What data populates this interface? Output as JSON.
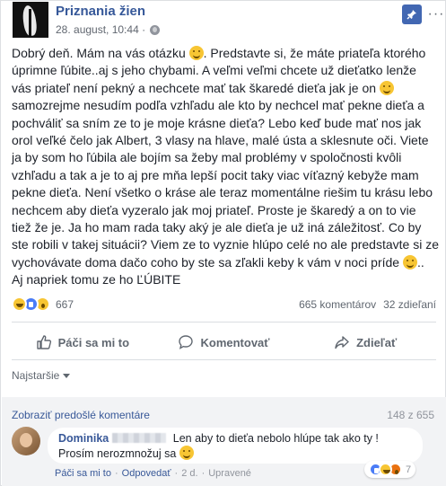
{
  "post": {
    "page_name": "Priznania žien",
    "date": "28. august, 10:44 ·",
    "text": {
      "l1": "Dobrý deň. Mám na vás otázku",
      "l1b": ". Predstavte si, že máte priateľa ktorého",
      "l2": "úprimne ľúbite..aj s jeho chybami. A veľmi veľmi chcete už dieťatko lenže",
      "l3": "vás priateľ není pekný a nechcete mať tak škaredé dieťa jak je on",
      "l4": "samozrejme nesudím podľa vzhľadu ale kto by nechcel mať pekne dieťa a",
      "l5": "pochváliť sa sním ze to je moje krásne dieťa? Lebo keď bude mať nos jak",
      "l6": "orol veľké čelo jak Albert, 3 vlasy na hlave, malé ústa a sklesnute oči. Viete",
      "l7": "ja by som ho ľúbila ale bojím sa žeby mal problémy v spoločnosti kvôli",
      "l8": "vzhľadu a tak a je to aj pre mňa lepší pocit taky viac víťazný kebyže mam",
      "l9": "pekne dieťa. Není všetko o kráse ale teraz momentálne riešim tu krásu lebo",
      "l10": "nechcem aby dieťa vyzeralo jak moj priateľ. Proste je škaredý a on to vie",
      "l11": "tiež že je. Ja ho mam rada taky aký je ale dieťa je už iná záležitosť. Co by",
      "l12": "ste robili v takej situácii? Viem ze to vyznie hlúpo celé no ale predstavte si ze",
      "l13": "vychovávate doma dačo coho by ste sa zľakli keby k vám v noci príde",
      "l13b": "..",
      "l14": "Aj napriek tomu ze ho ĽÚBITE"
    },
    "reaction_count": "667",
    "comments_count": "665 komentárov",
    "shares_count": "32 zdieľaní"
  },
  "actions": {
    "like": "Páči sa mi to",
    "comment": "Komentovať",
    "share": "Zdieľať"
  },
  "sort_label": "Najstaršie",
  "comments": {
    "previous_link": "Zobraziť predošlé komentáre",
    "counter": "148 z 655",
    "first": {
      "author": "Dominika",
      "text1": "Len aby to dieťa nebolo hlúpe tak ako ty !",
      "text2": "Prosím nerozmnožuj sa",
      "reactions": "7",
      "like": "Páči sa mi to",
      "reply": "Odpovedať",
      "time": "2 d.",
      "edited": "Upravené",
      "sep": "·"
    }
  },
  "colors": {
    "link": "#385898",
    "brand": "#4267b2"
  },
  "icons": [
    "globe-icon",
    "pin-icon",
    "more-icon",
    "like-icon",
    "comment-icon",
    "share-icon",
    "caret-down-icon"
  ]
}
